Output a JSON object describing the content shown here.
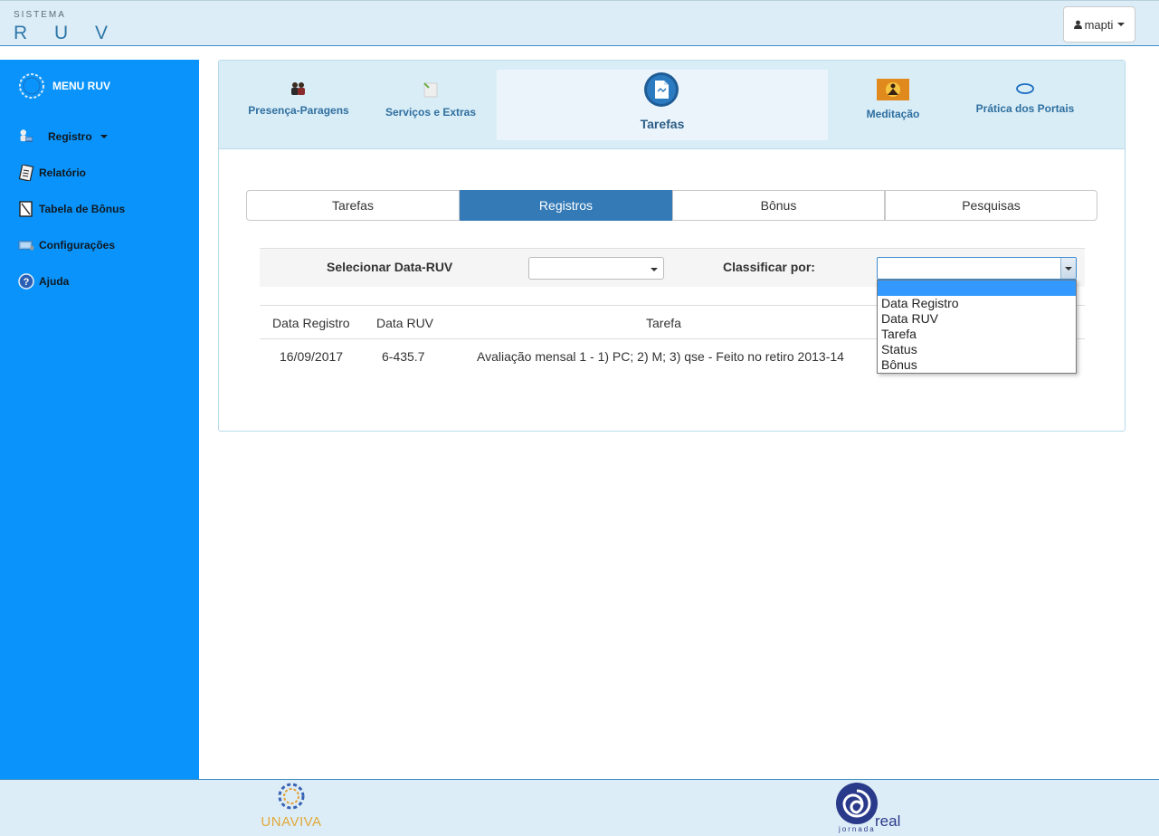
{
  "header": {
    "brand_small": "SISTEMA",
    "brand_big": "R U V",
    "user_label": "mapti"
  },
  "sidebar": {
    "title": "MENU RUV",
    "items": [
      {
        "label": "Registro",
        "icon": "user-computer-icon"
      },
      {
        "label": "Relatório",
        "icon": "report-icon"
      },
      {
        "label": "Tabela de Bônus",
        "icon": "table-icon"
      },
      {
        "label": "Configurações",
        "icon": "settings-icon"
      },
      {
        "label": "Ajuda",
        "icon": "help-icon"
      }
    ]
  },
  "nav": {
    "items": [
      {
        "label": "Presença-Paragens",
        "icon": "people-icon"
      },
      {
        "label": "Serviços e Extras",
        "icon": "services-icon"
      },
      {
        "label": "Tarefas",
        "icon": "document-icon",
        "active": true
      },
      {
        "label": "Meditação",
        "icon": "meditation-icon"
      },
      {
        "label": "Prática dos Portais",
        "icon": "portal-icon"
      }
    ]
  },
  "tabs": [
    "Tarefas",
    "Registros",
    "Bônus",
    "Pesquisas"
  ],
  "active_tab": "Registros",
  "filter": {
    "date_label": "Selecionar Data-RUV",
    "date_value": "",
    "sort_label": "Classificar por:",
    "sort_value": "",
    "sort_options": [
      "",
      "Data Registro",
      "Data RUV",
      "Tarefa",
      "Status",
      "Bônus"
    ]
  },
  "table": {
    "headers": [
      "Data Registro",
      "Data RUV",
      "Tarefa"
    ],
    "rows": [
      [
        "16/09/2017",
        "6-435.7",
        "Avaliação mensal 1 - 1) PC; 2) M; 3) qse - Feito no retiro 2013-14"
      ]
    ]
  },
  "footer": {
    "logo_left": "UNAVIVA",
    "logo_right": "real",
    "logo_right_sub": "jornada"
  },
  "colors": {
    "sidebar": "#0a94fb",
    "accent": "#337ab7",
    "header_bg": "#ddedf7",
    "highlight": "#3399ff"
  }
}
